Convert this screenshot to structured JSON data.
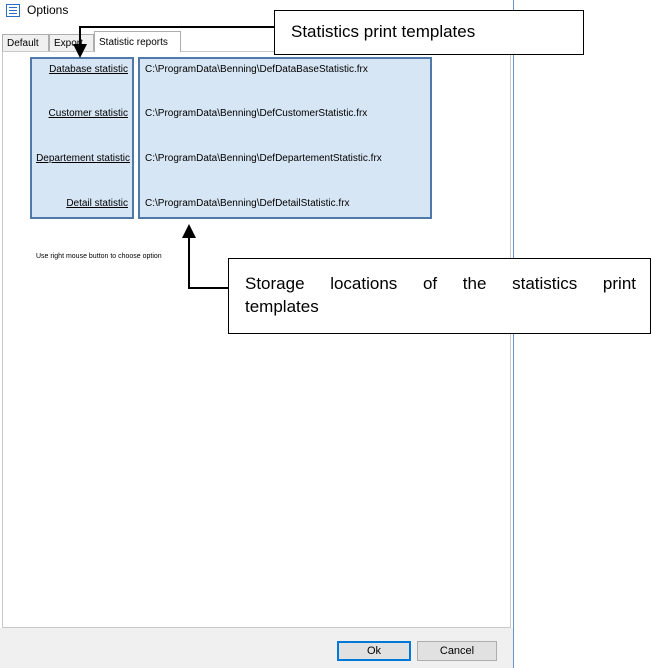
{
  "window": {
    "title": "Options"
  },
  "tabs": [
    {
      "label": "Default"
    },
    {
      "label": "Export"
    },
    {
      "label": "Statistic reports"
    }
  ],
  "statistics": [
    {
      "link": "Database statistic",
      "path": "C:\\ProgramData\\Benning\\DefDataBaseStatistic.frx"
    },
    {
      "link": "Customer statistic",
      "path": "C:\\ProgramData\\Benning\\DefCustomerStatistic.frx"
    },
    {
      "link": "Departement statistic",
      "path": "C:\\ProgramData\\Benning\\DefDepartementStatistic.frx"
    },
    {
      "link": "Detail statistic",
      "path": "C:\\ProgramData\\Benning\\DefDetailStatistic.frx"
    }
  ],
  "hint": "Use right mouse button to choose option",
  "buttons": {
    "ok": "Ok",
    "cancel": "Cancel"
  },
  "annotations": {
    "templates": "Statistics print templates",
    "storage_line1": "Storage locations of the statistics print",
    "storage_line2": "templates"
  },
  "colors": {
    "highlight_fill": "#d7e6f4",
    "highlight_border": "#4f79a9",
    "accent": "#0078d7"
  }
}
